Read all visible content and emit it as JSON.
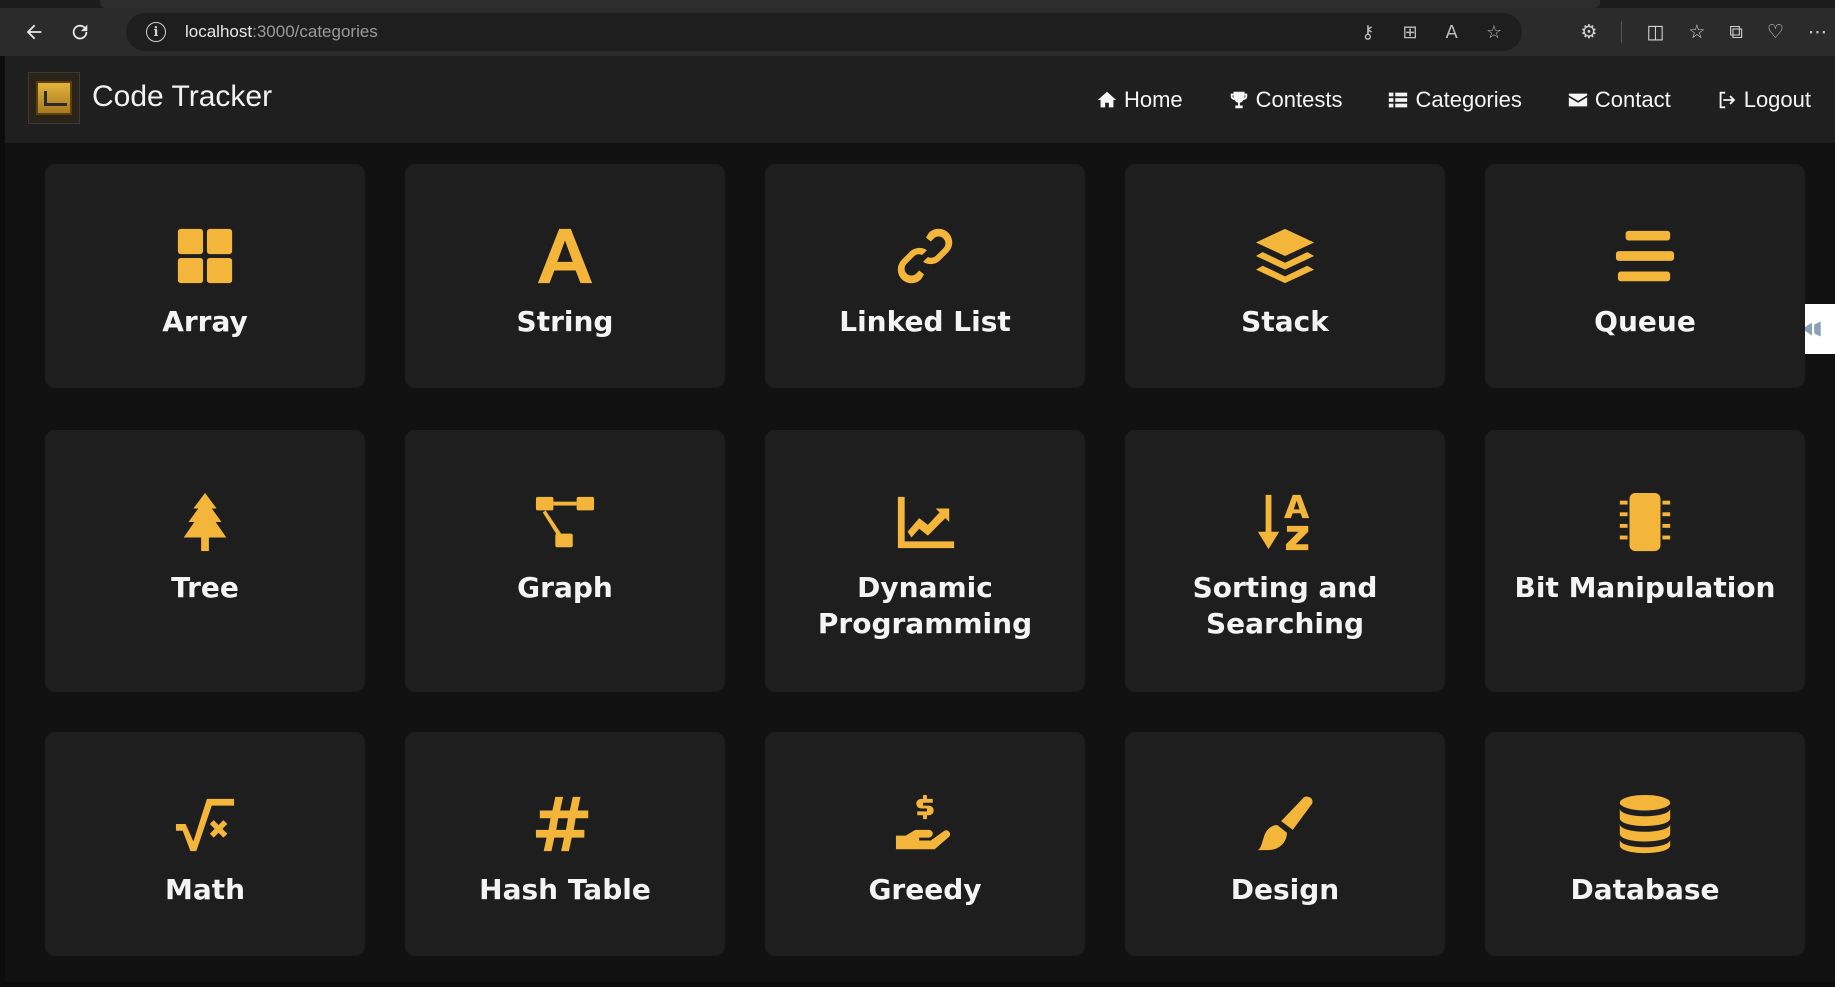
{
  "browser": {
    "url_host": "localhost",
    "url_rest": ":3000/categories"
  },
  "navbar": {
    "brand": "Code Tracker",
    "links": [
      {
        "label": "Home",
        "icon": "home-icon"
      },
      {
        "label": "Contests",
        "icon": "trophy-icon"
      },
      {
        "label": "Categories",
        "icon": "list-icon"
      },
      {
        "label": "Contact",
        "icon": "envelope-icon"
      },
      {
        "label": "Logout",
        "icon": "logout-icon"
      }
    ]
  },
  "accent_color": "#f3b63b",
  "categories": [
    {
      "label": "Array",
      "icon": "grid-icon"
    },
    {
      "label": "String",
      "icon": "letter-a-icon"
    },
    {
      "label": "Linked List",
      "icon": "link-icon"
    },
    {
      "label": "Stack",
      "icon": "layers-icon"
    },
    {
      "label": "Queue",
      "icon": "queue-icon"
    },
    {
      "label": "Tree",
      "icon": "tree-icon"
    },
    {
      "label": "Graph",
      "icon": "graph-icon"
    },
    {
      "label": "Dynamic Programming",
      "icon": "chart-line-icon"
    },
    {
      "label": "Sorting and Searching",
      "icon": "sort-az-icon"
    },
    {
      "label": "Bit Manipulation",
      "icon": "chip-icon"
    },
    {
      "label": "Math",
      "icon": "square-root-icon"
    },
    {
      "label": "Hash Table",
      "icon": "hashtag-icon"
    },
    {
      "label": "Greedy",
      "icon": "hand-dollar-icon"
    },
    {
      "label": "Design",
      "icon": "paintbrush-icon"
    },
    {
      "label": "Database",
      "icon": "database-icon"
    }
  ]
}
